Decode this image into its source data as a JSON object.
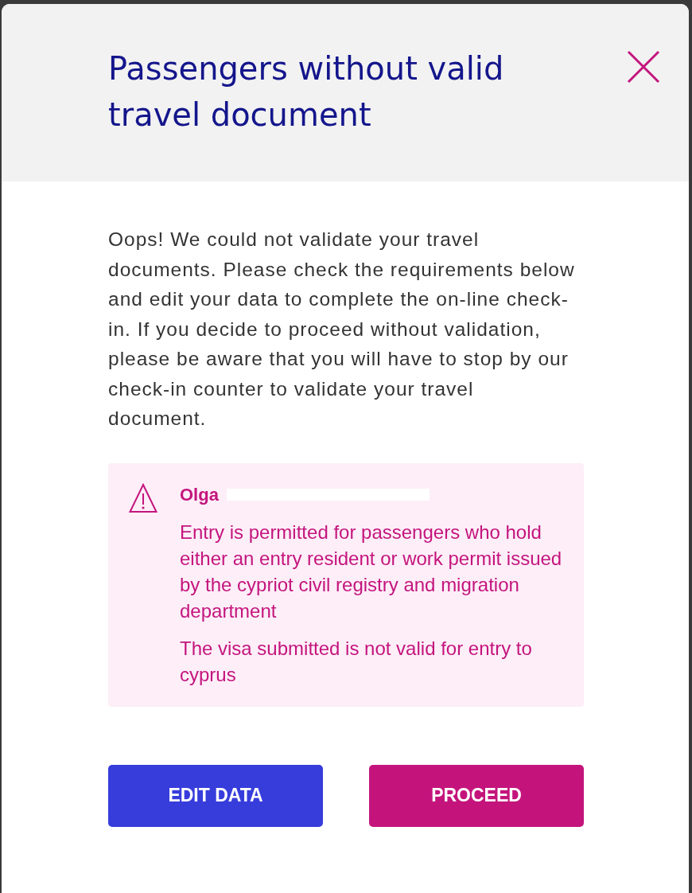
{
  "dialog": {
    "title": "Passengers without valid travel document"
  },
  "message": "Oops! We could not validate your travel documents. Please check the requirements below and edit your data to complete the on-line check-in. If you decide to proceed without validation, please be aware that you will have to stop by our check-in counter to validate your travel document.",
  "alert": {
    "passenger_name": "Olga",
    "name_redacted": true,
    "messages": [
      "Entry is permitted for passengers who hold either an entry resident or work permit issued by the cypriot civil registry and migration department",
      "The visa submitted is not valid for entry to cyprus"
    ]
  },
  "buttons": [
    {
      "label": "EDIT DATA",
      "kind": "primary"
    },
    {
      "label": "PROCEED",
      "kind": "accent"
    }
  ]
}
